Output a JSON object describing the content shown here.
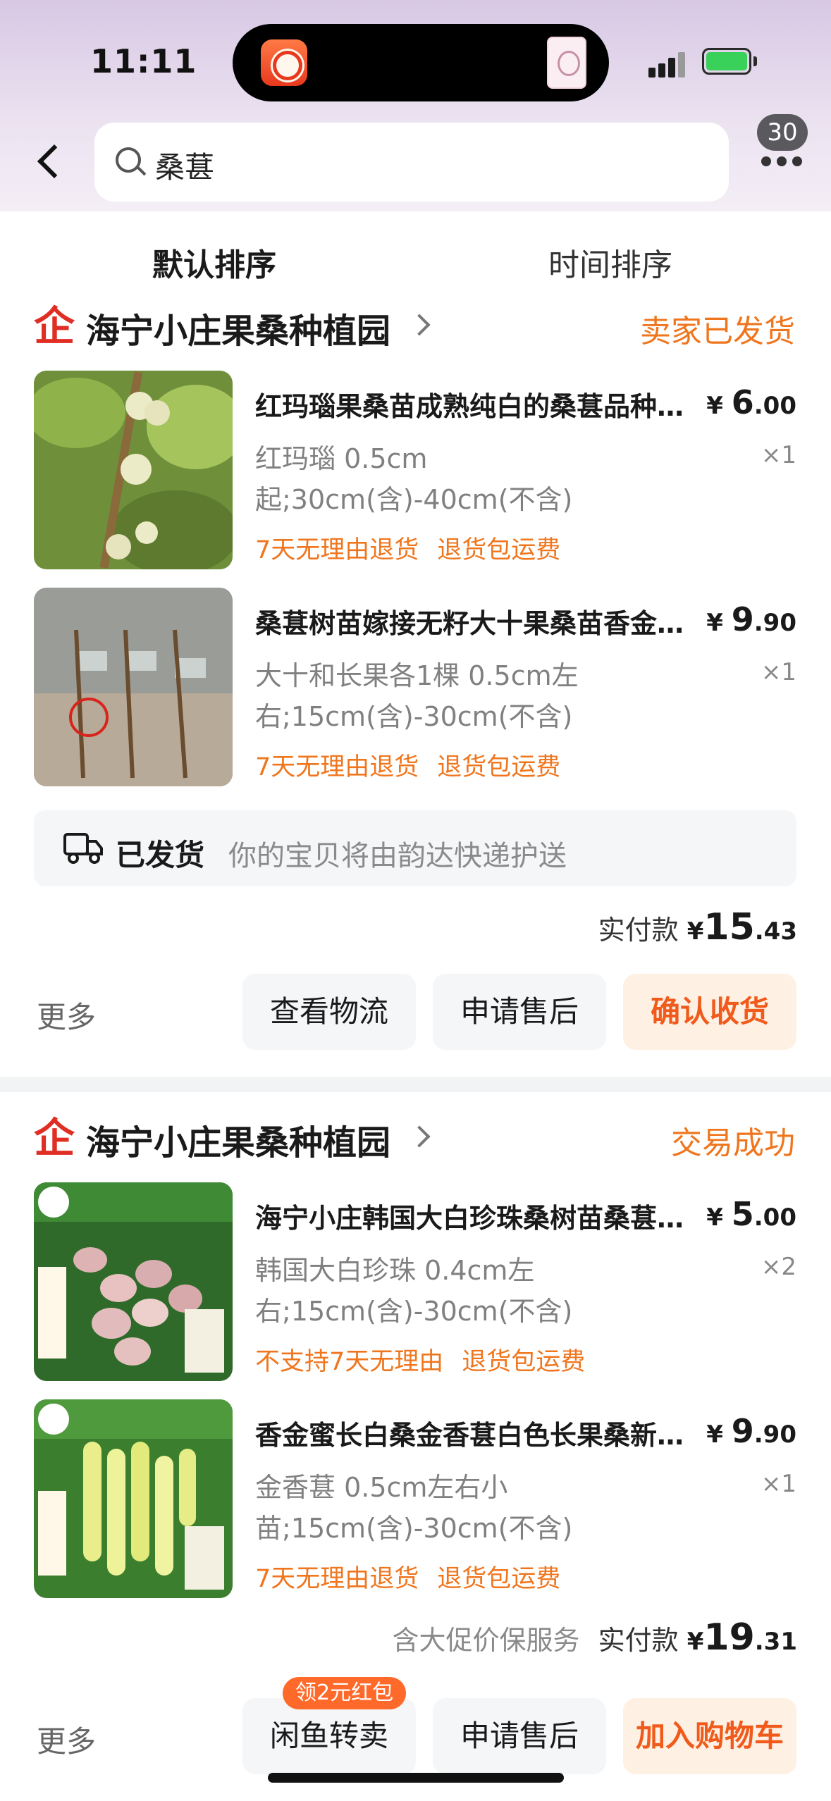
{
  "status_bar": {
    "time": "11:11"
  },
  "search": {
    "query": "桑葚",
    "more_count": "30"
  },
  "sort_tabs": {
    "default": "默认排序",
    "time": "时间排序"
  },
  "orders": [
    {
      "shop_name": "海宁小庄果桑种植园",
      "status": "卖家已发货",
      "items": [
        {
          "title": "红玛瑙果桑苗成熟纯白的桑葚品种…",
          "price_symbol": "¥",
          "price_int": "6",
          "price_dec": ".00",
          "spec": "红玛瑙 0.5cm起;30cm(含)-40cm(不含)",
          "qty": "×1",
          "tags": [
            "7天无理由退货",
            "退货包运费"
          ]
        },
        {
          "title": "桑葚树苗嫁接无籽大十果桑苗香金…",
          "price_symbol": "¥",
          "price_int": "9",
          "price_dec": ".90",
          "spec": "大十和长果各1棵 0.5cm左右;15cm(含)-30cm(不含)",
          "qty": "×1",
          "tags": [
            "7天无理由退货",
            "退货包运费"
          ]
        }
      ],
      "shipping": {
        "label": "已发货",
        "text": "你的宝贝将由韵达快递护送"
      },
      "paid": {
        "label": "实付款",
        "symbol": "¥",
        "int": "15",
        "dec": ".43"
      },
      "actions": {
        "more": "更多",
        "b1": "查看物流",
        "b2": "申请售后",
        "b3": "确认收货"
      }
    },
    {
      "shop_name": "海宁小庄果桑种植园",
      "status": "交易成功",
      "items": [
        {
          "title": "海宁小庄韩国大白珍珠桑树苗桑葚…",
          "price_symbol": "¥",
          "price_int": "5",
          "price_dec": ".00",
          "spec": "韩国大白珍珠 0.4cm左右;15cm(含)-30cm(不含)",
          "qty": "×2",
          "tags": [
            "不支持7天无理由",
            "退货包运费"
          ]
        },
        {
          "title": "香金蜜长白桑金香葚白色长果桑新…",
          "price_symbol": "¥",
          "price_int": "9",
          "price_dec": ".90",
          "spec": "金香葚 0.5cm左右小苗;15cm(含)-30cm(不含)",
          "qty": "×1",
          "tags": [
            "7天无理由退货",
            "退货包运费"
          ]
        }
      ],
      "paid": {
        "note": "含大促价保服务",
        "label": "实付款",
        "symbol": "¥",
        "int": "19",
        "dec": ".31"
      },
      "actions": {
        "more": "更多",
        "b1": "闲鱼转卖",
        "b2": "申请售后",
        "b3": "加入购物车",
        "promo": "领2元红包"
      }
    }
  ],
  "colors": {
    "accent_orange": "#f0761e",
    "brand_red": "#e02e24",
    "battery_green": "#3ad15b"
  }
}
